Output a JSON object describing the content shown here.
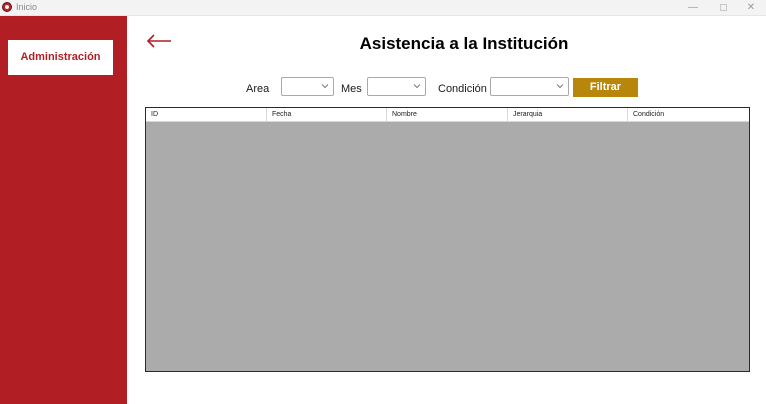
{
  "window": {
    "title": "Inicio"
  },
  "sidebar": {
    "admin_label": "Administración"
  },
  "page": {
    "title": "Asistencia a la Institución"
  },
  "filters": {
    "area_label": "Area",
    "mes_label": "Mes",
    "condicion_label": "Condición",
    "area_value": "",
    "mes_value": "",
    "condicion_value": "",
    "button_label": "Filtrar"
  },
  "grid": {
    "columns": [
      "ID",
      "Fecha",
      "Nombre",
      "Jerarquia",
      "Condición"
    ],
    "rows": []
  },
  "colors": {
    "sidebar": "#b11f24",
    "filter_button": "#b8860b",
    "grid_background": "#ababab"
  }
}
